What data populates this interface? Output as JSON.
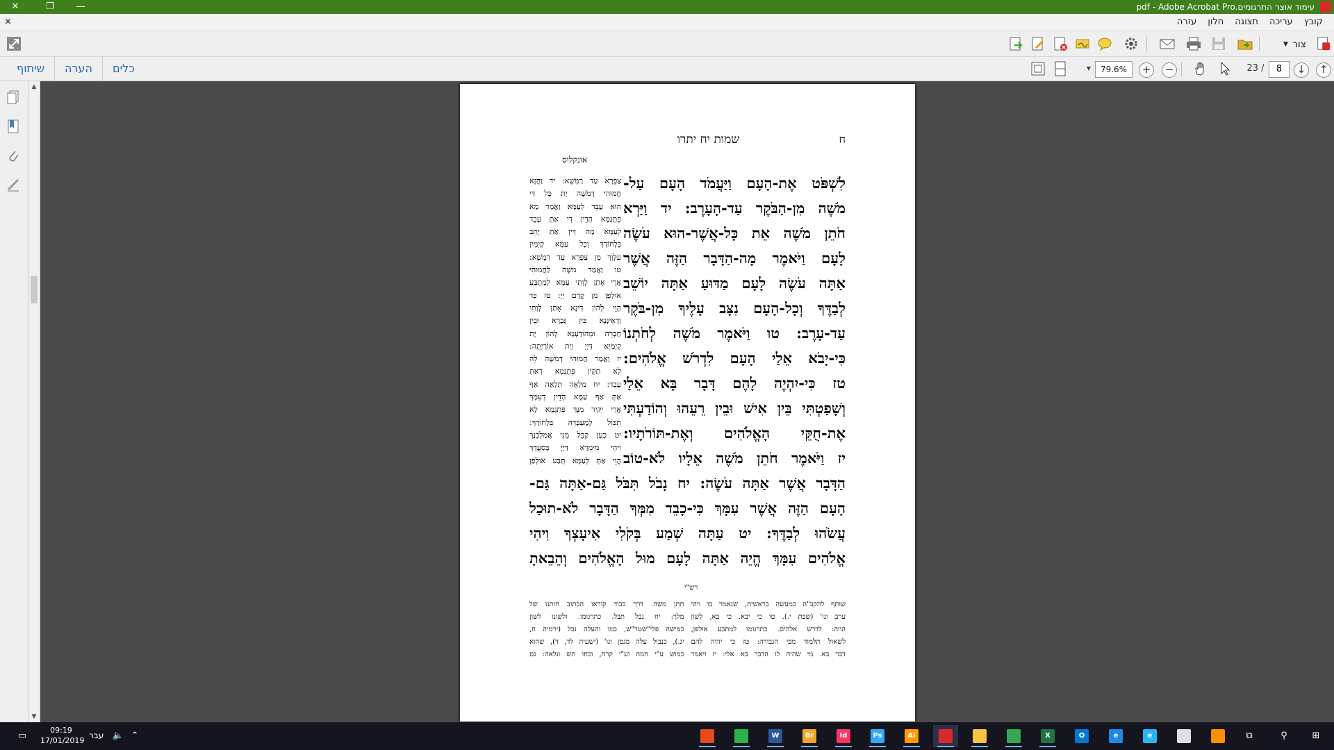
{
  "titlebar": {
    "title": "pdf - Adobe Acrobat Pro.עימוד אוצר התרגומים",
    "close": "✕",
    "restore": "❐",
    "minimize": "—"
  },
  "menubar": {
    "items": [
      "קובץ",
      "עריכה",
      "תצוגה",
      "חלון",
      "עזרה"
    ],
    "close": "×"
  },
  "toolbar1": {
    "create_label": "צור"
  },
  "toolbar2": {
    "links": [
      "שיתוף",
      "הערה",
      "כלים"
    ],
    "zoom": "79.6%",
    "page_current": "8",
    "page_total": "23 /"
  },
  "document": {
    "page_number": "ח",
    "running_head": "שמות יח יתרו",
    "onkelos_heading": "אונקלוס",
    "main_lines": [
      "לִשְׁפֹּט אֶת-הָעָם וַיַּעֲמֹד הָעָם עַל-",
      "מֹשֶׁה מִן-הַבֹּקֶר עַד-הָעָרֶב: יד וַיַּרְא",
      "חֹתֵן מֹשֶׁה אֵת כָּל-אֲשֶׁר-הוּא עֹשֶׂה",
      "לָעָם וַיֹּאמֶר מָה-הַדָּבָר הַזֶּה אֲשֶׁר",
      "אַתָּה עֹשֶׂה לָעָם מַדּוּעַ אַתָּה יוֹשֵׁב",
      "לְבַדֶּךָ וְכָל-הָעָם נִצָּב עָלֶיךָ מִן-בֹּקֶר",
      "עַד-עָרֶב: טו וַיֹּאמֶר מֹשֶׁה לְחֹתְנוֹ",
      "כִּי-יָבֹא אֵלַי הָעָם לִדְרֹשׁ אֱלֹהִים:",
      "טז כִּי-יִהְיֶה לָהֶם דָּבָר בָּא אֵלַי",
      "וְשָׁפַטְתִּי בֵּין אִישׁ וּבֵין רֵעֵהוּ וְהוֹדַעְתִּי",
      "אֶת-חֻקֵּי הָאֱלֹהִים וְאֶת-תּוֹרֹתָיו:",
      "יז וַיֹּאמֶר חֹתֵן מֹשֶׁה אֵלָיו לֹא-טוֹב",
      "הַדָּבָר אֲשֶׁר אַתָּה עֹשֶׂה: יח נָבֹל תִּבֹּל גַּם-אַתָּה גַּם-",
      "הָעָם הַזֶּה אֲשֶׁר עִמָּךְ כִּי-כָבֵד מִמְּךָ הַדָּבָר לֹא-תוּכַל",
      "עֲשֹׂהוּ לְבַדֶּךָ: יט עַתָּה שְׁמַע בְּקֹלִי אִיעָצְךָ וִיהִי",
      "אֱלֹהִים עִמָּךְ הֱיֵה אַתָּה לָעָם מוּל הָאֱלֹהִים וְהֵבֵאתָ"
    ],
    "onkelos_lines": [
      "צַפְרָא עַד רַמְשָׁא: יד וַחֲזָא",
      "חֲמוּהִי דְמֹשֶׁה יָת כָּל דִּי",
      "הוּא עָבֵד לְעַמָּא וַאֲמַר מָא",
      "פִתְגָמָא הָדֵין דִּי אַתְּ עָבֵד",
      "לְעַמָּא מָה דֵּין אַתְּ יָתֵב",
      "בִּלְחוֹדָךְ וְכָל עַמָּא קָיְמִין",
      "עִלָּוָךְ מִן צַפְרָא עַד רַמְשָׁא:",
      "טו וַאֲמַר מֹשֶׁה לַחֲמוּהִי",
      "אֲרֵי אָתַן לְוָתִי עַמָּא לְמִתְבַּע",
      "אוּלְפַן מִן קֳדָם יְיָ: טז כַּד",
      "הָוֵי לְהוֹן דִּינָא אָתַן לְוָתִי",
      "וְדָאֵינְנָא בֵּין גַּבְרָא וּבֵין",
      "חַבְרֵהּ וּמְהוֹדַעְנָא לְהוֹן יָת",
      "קְיָמַיָּא דַּיְיָ וְיָת אוֹרָיָתֵהּ:",
      "יז וַאֲמַר חֲמוּהִי דְמֹשֶׁה לֵהּ",
      "לָא תַקִּין פִּתְגָמָא דְאַתְּ",
      "עָבֵד: יח מִלְאָה תִלְאֵה אַף",
      "אַתְּ אַף עַמָּא הָדֵין דְעִמָּךְ",
      "אֲרֵי יַקִּיר מִנָּךְ פִּתְגָמָא לָא",
      "תִכּוֹל לְמֶעְבְּדֵהּ בִּלְחוֹדָךְ:",
      "יט כְּעַן קַבֵּל מִנִּי אֲמַלְכִנָּךְ",
      "וִיהֵי מֵימְרָא דַּיְיָ בְּסַעֲדָךְ",
      "הֲוֵי אַתְּ לְעַמָּא תָּבַע אוּלְפַן"
    ],
    "rashi_heading": "רש\"י",
    "rashi_right": [
      "שותף להקב\"ה במעשה בראשית, שנאמר בו ויהי",
      "ערב וגו' (שבת י.). טו כי יבא. כי בא, לשון",
      "הווה: לדרש אלהים. כתרגומו למתבע אולפן,",
      "לשאול תלמוד מפי הגבורה: טז כי יהיה להם",
      "דבר בא. מי שהיה לו הדבר בא אלי: יז ויאמר"
    ],
    "rashi_left": [
      "חתן משה. דרך כבוד קוראו הכתוב חותנו של",
      "מלך: יח נבל תבל. כתרגומו. ולשונו לשון",
      "כמישה פלי\"שטר\"ש, כמו והעלה נבל (ירמיה ח,",
      "יג.), כנבול עלה מגפן וגו' (ישעיה לד, ד), שהוא",
      "כמוש ע\"י חמה וע\"י קרח, וכחו תש ונלאה: גם"
    ]
  },
  "taskbar": {
    "time": "09:19",
    "date": "17/01/2019",
    "language": "עבר",
    "apps": [
      {
        "name": "acrobat-app",
        "label": "",
        "color": "#e64a19"
      },
      {
        "name": "camtasia-app",
        "label": "",
        "color": "#2bb24c"
      },
      {
        "name": "word-app",
        "label": "W",
        "color": "#2b579a"
      },
      {
        "name": "bridge-app",
        "label": "Br",
        "color": "#f5a623"
      },
      {
        "name": "indesign-app",
        "label": "Id",
        "color": "#ff3366"
      },
      {
        "name": "photoshop-app",
        "label": "Ps",
        "color": "#31a8ff"
      },
      {
        "name": "illustrator-app",
        "label": "Ai",
        "color": "#ff9a00"
      },
      {
        "name": "pdf-app",
        "label": "",
        "color": "#d62b2b"
      },
      {
        "name": "explorer-app",
        "label": "",
        "color": "#f5c542"
      },
      {
        "name": "chrome-app",
        "label": "",
        "color": "#34a853"
      },
      {
        "name": "excel-app",
        "label": "X",
        "color": "#217346"
      },
      {
        "name": "outlook-app",
        "label": "O",
        "color": "#0078d4"
      },
      {
        "name": "edge-app",
        "label": "e",
        "color": "#1e88e5"
      },
      {
        "name": "ie-app",
        "label": "e",
        "color": "#29b6f6"
      },
      {
        "name": "paint-app",
        "label": "",
        "color": "#e0e0e0"
      },
      {
        "name": "search-app",
        "label": "",
        "color": "#ff8f00"
      }
    ]
  }
}
